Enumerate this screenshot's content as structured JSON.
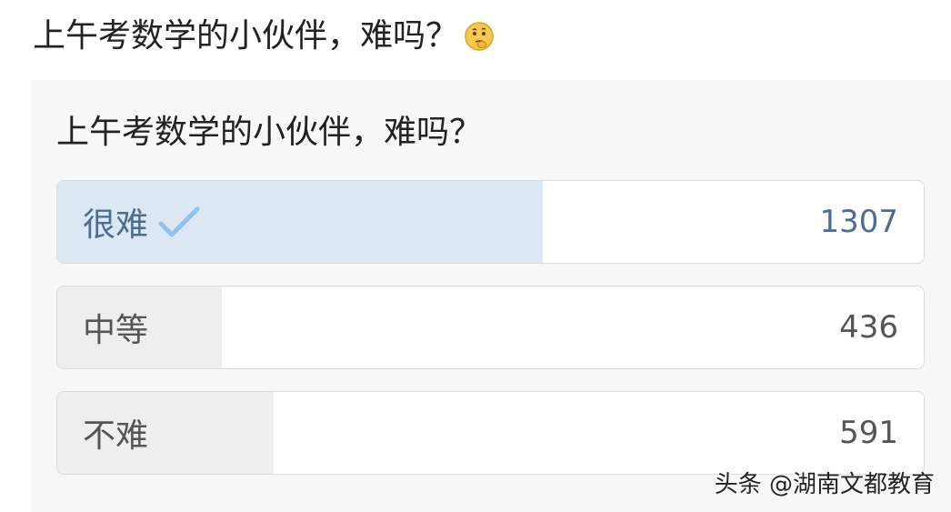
{
  "post": {
    "title": "上午考数学的小伙伴，难吗？",
    "emoji_icon": "thinking-face-icon"
  },
  "poll": {
    "question": "上午考数学的小伙伴，难吗？",
    "options": [
      {
        "label": "很难",
        "count": "1307",
        "share": 0.56,
        "selected": true
      },
      {
        "label": "中等",
        "count": "436",
        "share": 0.19,
        "selected": false
      },
      {
        "label": "不难",
        "count": "591",
        "share": 0.25,
        "selected": false
      }
    ],
    "selected_icon": "checkmark-icon"
  },
  "watermark": "头条 @湖南文都教育",
  "colors": {
    "selected_fill": "#dbe8f3",
    "unselected_fill": "#eeeeee",
    "selected_text": "#4d6c91",
    "check": "#8fc3ec"
  }
}
